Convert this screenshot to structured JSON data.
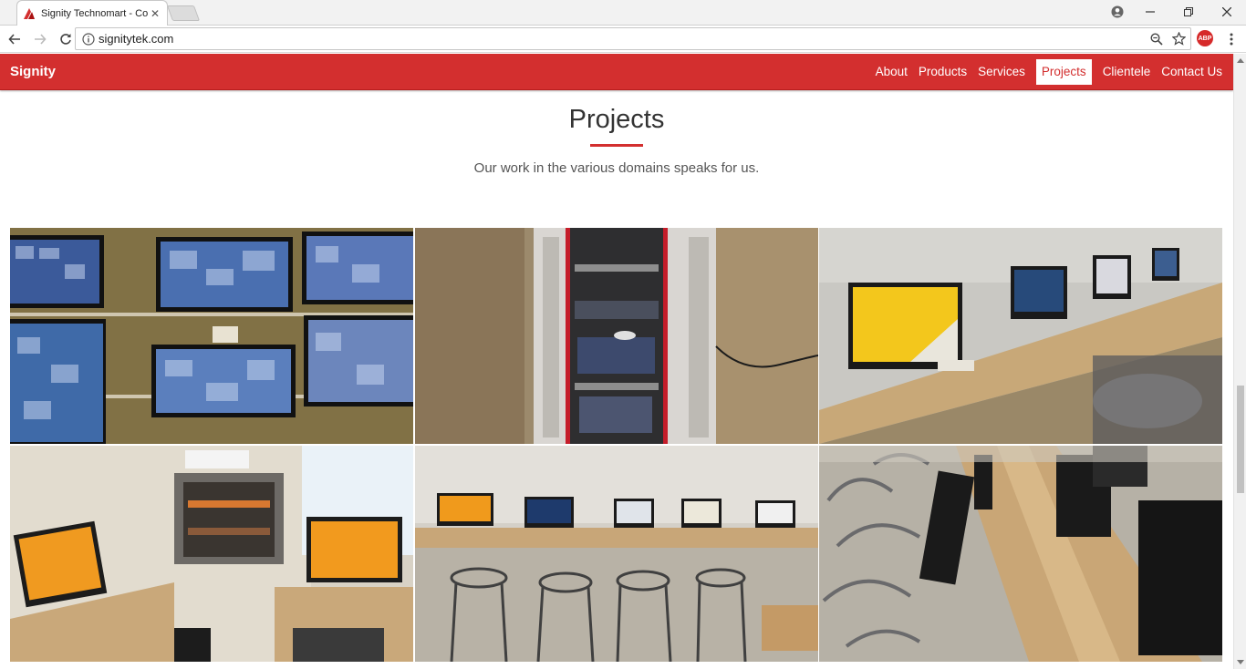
{
  "browser": {
    "tab_title": "Signity Technomart - Co",
    "tab_favicon": "signity-logo-icon",
    "url": "signitytek.com",
    "extension_label": "ABP"
  },
  "site": {
    "brand": "Signity",
    "nav": [
      {
        "label": "About",
        "active": false
      },
      {
        "label": "Products",
        "active": false
      },
      {
        "label": "Services",
        "active": false
      },
      {
        "label": "Projects",
        "active": true
      },
      {
        "label": "Clientele",
        "active": false
      },
      {
        "label": "Contact Us",
        "active": false
      }
    ],
    "section": {
      "title": "Projects",
      "subtitle": "Our work in the various domains speaks for us."
    },
    "gallery": [
      {
        "subject": "CCTV monitoring wall"
      },
      {
        "subject": "Server rack cabinet"
      },
      {
        "subject": "Computer lab desks"
      },
      {
        "subject": "Wall-mounted rack with desktops"
      },
      {
        "subject": "Row of lab workstations"
      },
      {
        "subject": "Lab chairs and monitors"
      }
    ]
  },
  "colors": {
    "brand_red": "#d32f2f",
    "text_dark": "#333333",
    "text_muted": "#555555"
  }
}
